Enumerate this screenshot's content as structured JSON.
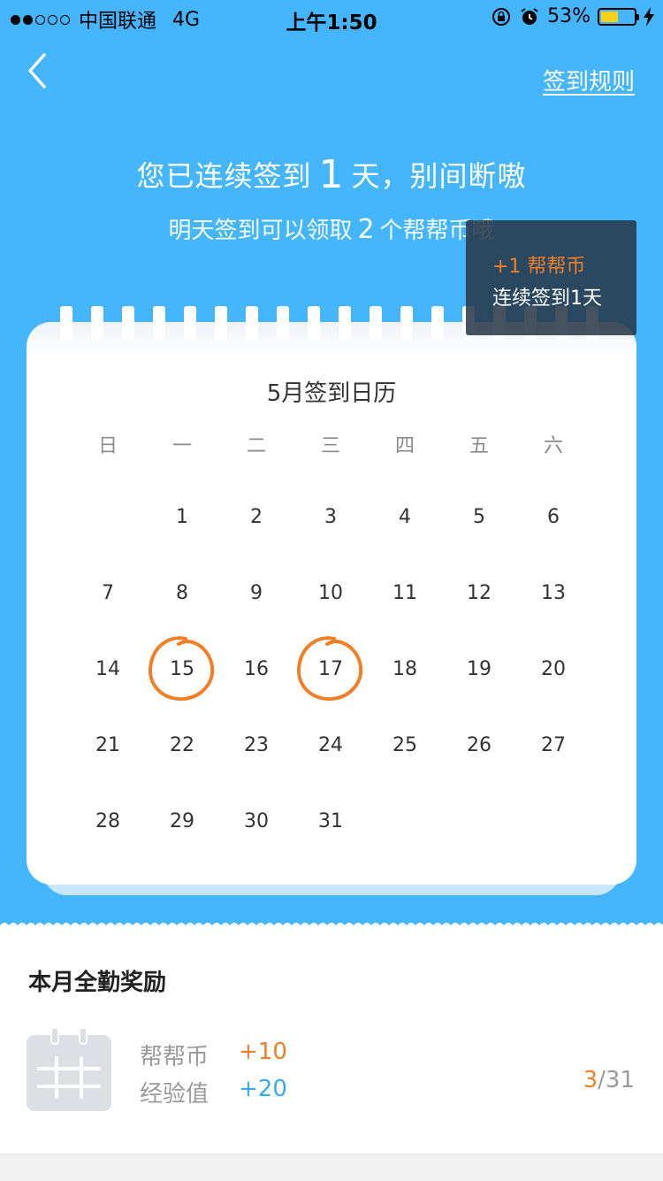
{
  "status_bar": {
    "carrier": "中国联通",
    "network": "4G",
    "time": "上午1:50",
    "battery": "53%",
    "battery_level": 0.53
  },
  "nav": {
    "rules_link": "签到规则"
  },
  "header": {
    "headline_prefix": "您已连续签到",
    "streak_days": "1",
    "headline_suffix": "天，别间断嗷",
    "subline_prefix": "明天签到可以领取",
    "tomorrow_coins": "2",
    "subline_suffix": "个帮帮币哦"
  },
  "tooltip": {
    "reward": "+1 帮帮币",
    "streak": "连续签到1天"
  },
  "calendar": {
    "title": "5月签到日历",
    "weekdays": [
      "日",
      "一",
      "二",
      "三",
      "四",
      "五",
      "六"
    ],
    "first_weekday_index": 1,
    "days_in_month": 31,
    "signed_days": [
      15,
      17
    ],
    "accent_color": "#f07f2a"
  },
  "reward": {
    "title": "本月全勤奖励",
    "coin_label": "帮帮币",
    "coin_value": "+10",
    "exp_label": "经验值",
    "exp_value": "+20",
    "progress_current": "3",
    "progress_total": "/31"
  },
  "colors": {
    "background_blue": "#45b6fd",
    "orange": "#f07f2a",
    "blue_text": "#3aa9ee"
  }
}
